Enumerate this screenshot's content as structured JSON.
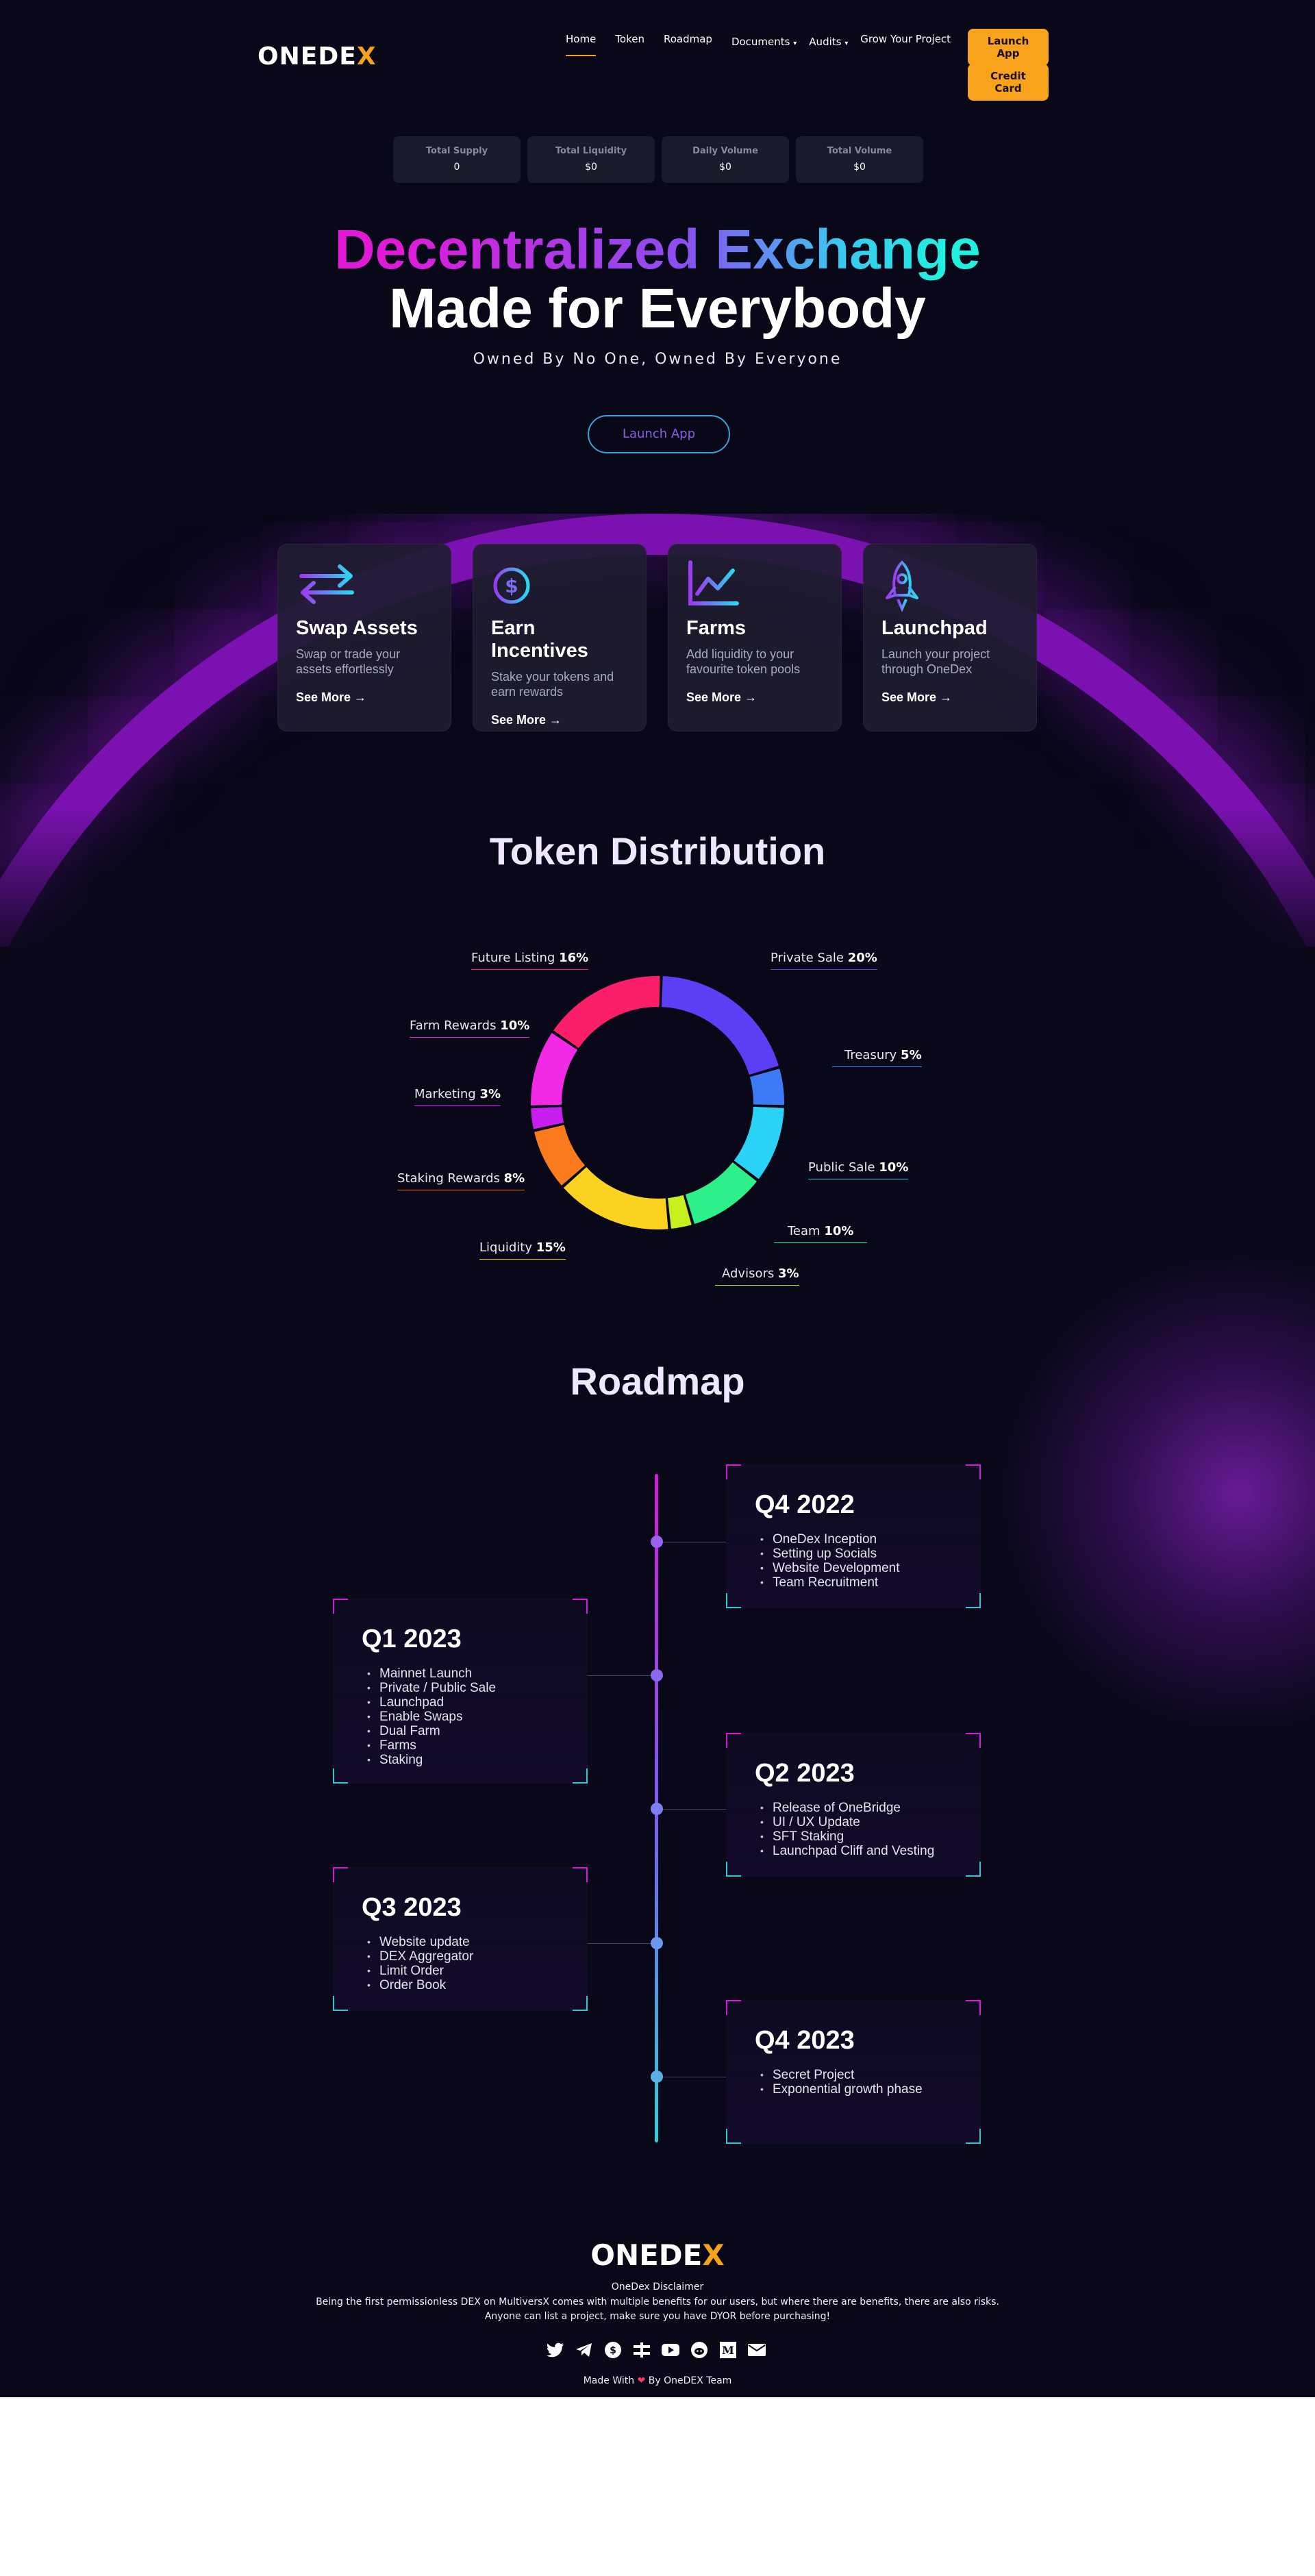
{
  "brand": {
    "logo_left": "ONEDE",
    "logo_right": "X"
  },
  "nav": {
    "items": [
      {
        "label": "Home"
      },
      {
        "label": "Token"
      },
      {
        "label": "Roadmap"
      },
      {
        "label": "Documents"
      },
      {
        "label": "Audits"
      },
      {
        "label": "Grow Your Project"
      }
    ],
    "launch_app": "Launch App",
    "credit_card": "Credit Card"
  },
  "stats": [
    {
      "label": "Total Supply",
      "value": "0"
    },
    {
      "label": "Total Liquidity",
      "value": "$0"
    },
    {
      "label": "Daily Volume",
      "value": "$0"
    },
    {
      "label": "Total Volume",
      "value": "$0"
    }
  ],
  "hero": {
    "title_line1": "Decentralized Exchange",
    "title_line2": "Made for Everybody",
    "subtitle": "Owned By No One, Owned By Everyone",
    "cta": "Launch App"
  },
  "features": [
    {
      "icon": "swap-arrows-icon",
      "title": "Swap Assets",
      "desc1": "Swap or trade your",
      "desc2": "assets effortlessly",
      "more": "See More →"
    },
    {
      "icon": "coin-stack-icon",
      "title": "Earn Incentives",
      "desc1": "Stake your tokens and",
      "desc2": "earn rewards",
      "more": "See More →"
    },
    {
      "icon": "line-chart-icon",
      "title": "Farms",
      "desc1": "Add liquidity to your",
      "desc2": "favourite token pools",
      "more": "See More →"
    },
    {
      "icon": "rocket-icon",
      "title": "Launchpad",
      "desc1": "Launch your project",
      "desc2": "through OneDex",
      "more": "See More →"
    }
  ],
  "token_distribution": {
    "title": "Token Distribution",
    "labels": [
      {
        "name": "Future Listing",
        "pct": "16%"
      },
      {
        "name": "Private Sale",
        "pct": "20%"
      },
      {
        "name": "Farm Rewards",
        "pct": "10%"
      },
      {
        "name": "Treasury",
        "pct": "5%"
      },
      {
        "name": "Marketing",
        "pct": "3%"
      },
      {
        "name": "Public Sale",
        "pct": "10%"
      },
      {
        "name": "Staking Rewards",
        "pct": "8%"
      },
      {
        "name": "Team",
        "pct": "10%"
      },
      {
        "name": "Liquidity",
        "pct": "15%"
      },
      {
        "name": "Advisors",
        "pct": "3%"
      }
    ]
  },
  "chart_data": {
    "type": "pie",
    "title": "Token Distribution",
    "categories": [
      "Private Sale",
      "Treasury",
      "Public Sale",
      "Team",
      "Advisors",
      "Liquidity",
      "Staking Rewards",
      "Marketing",
      "Farm Rewards",
      "Future Listing"
    ],
    "values": [
      20,
      5,
      10,
      10,
      3,
      15,
      8,
      3,
      10,
      16
    ],
    "colors": [
      "#5b3ff5",
      "#3d7af5",
      "#2ad3f5",
      "#2ef08a",
      "#c6f01e",
      "#fcd221",
      "#fb7a1c",
      "#c81ff0",
      "#f32ae5",
      "#fb1f6a"
    ]
  },
  "roadmap": {
    "title": "Roadmap",
    "phases": [
      {
        "quarter": "Q4 2022",
        "items": [
          "OneDex Inception",
          "Setting up Socials",
          "Website Development",
          "Team Recruitment"
        ]
      },
      {
        "quarter": "Q1 2023",
        "items": [
          "Mainnet Launch",
          "Private / Public Sale",
          "Launchpad",
          "Enable Swaps",
          "Dual Farm",
          "Farms",
          "Staking"
        ]
      },
      {
        "quarter": "Q2 2023",
        "items": [
          "Release of  OneBridge",
          "UI / UX Update",
          "SFT Staking",
          "Launchpad Cliff and Vesting"
        ]
      },
      {
        "quarter": "Q3 2023",
        "items": [
          "Website update",
          "DEX Aggregator",
          "Limit Order",
          "Order Book"
        ]
      },
      {
        "quarter": "Q4 2023",
        "items": [
          "Secret Project",
          "Exponential growth phase"
        ]
      }
    ]
  },
  "footer": {
    "disclaimer_title": "OneDex Disclaimer",
    "disclaimer_line1": "Being the first permissionless DEX on MultiversX comes with multiple benefits for our users, but where there are benefits, there are also risks.",
    "disclaimer_line2": "Anyone can list a project, make sure you have DYOR before purchasing!",
    "made_with_prefix": "Made With",
    "made_with_suffix": "By OneDEX Team",
    "socials": [
      "twitter-icon",
      "telegram-icon",
      "coin-icon",
      "xexchange-icon",
      "youtube-icon",
      "reddit-icon",
      "medium-icon",
      "email-icon"
    ]
  },
  "colors": {
    "accent": "#f9a21b",
    "background": "#080818",
    "card": "#1a1b2a"
  }
}
